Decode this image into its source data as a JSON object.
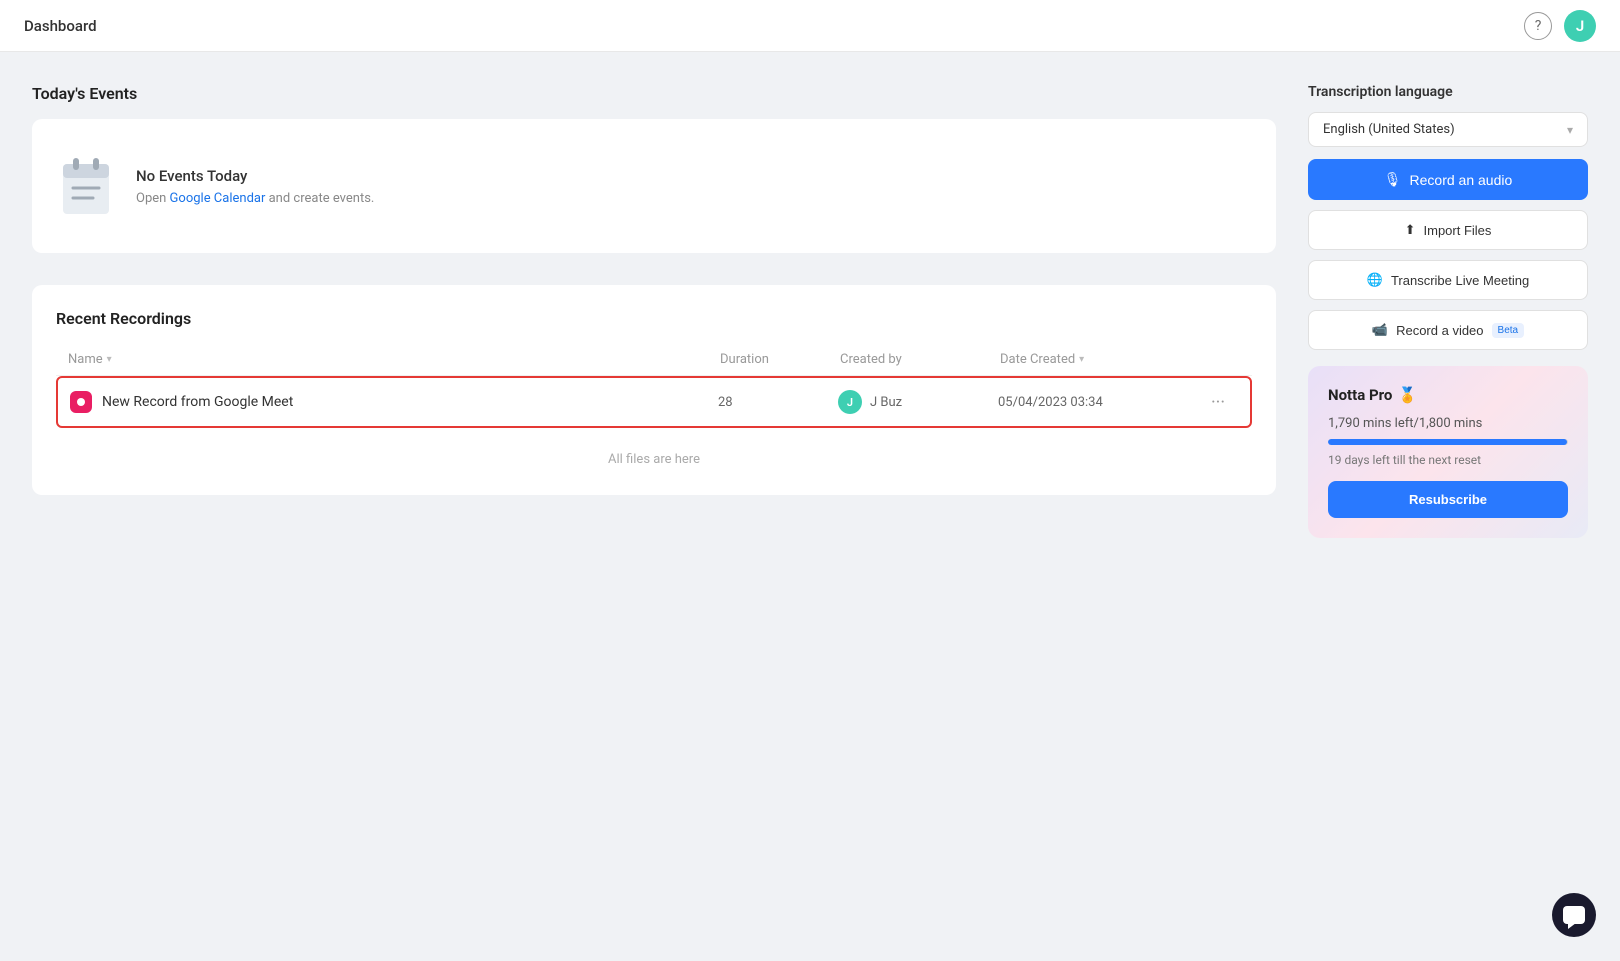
{
  "topbar": {
    "title": "Dashboard",
    "avatar_letter": "J"
  },
  "events_section": {
    "title": "Today's Events",
    "no_events_title": "No Events Today",
    "no_events_sub_prefix": "Open ",
    "google_calendar_link": "Google Calendar",
    "no_events_sub_suffix": " and create events."
  },
  "recordings_section": {
    "title": "Recent Recordings",
    "columns": {
      "name": "Name",
      "duration": "Duration",
      "created_by": "Created by",
      "date_created": "Date Created"
    },
    "rows": [
      {
        "name": "New Record from Google Meet",
        "duration": "28",
        "creator": "J Buz",
        "date": "05/04/2023 03:34"
      }
    ],
    "footer": "All files are here"
  },
  "sidebar": {
    "transcription_lang_label": "Transcription language",
    "language": "English (United States)",
    "record_audio_btn": "Record an audio",
    "import_files_btn": "Import Files",
    "transcribe_meeting_btn": "Transcribe Live Meeting",
    "record_video_btn": "Record a video",
    "beta_label": "Beta",
    "pro_card": {
      "title": "Notta Pro",
      "emoji": "🏅",
      "mins_text": "1,790 mins left/1,800 mins",
      "reset_text": "19 days left till the next reset",
      "resubscribe_btn": "Resubscribe",
      "progress_percent": 99.4
    }
  }
}
